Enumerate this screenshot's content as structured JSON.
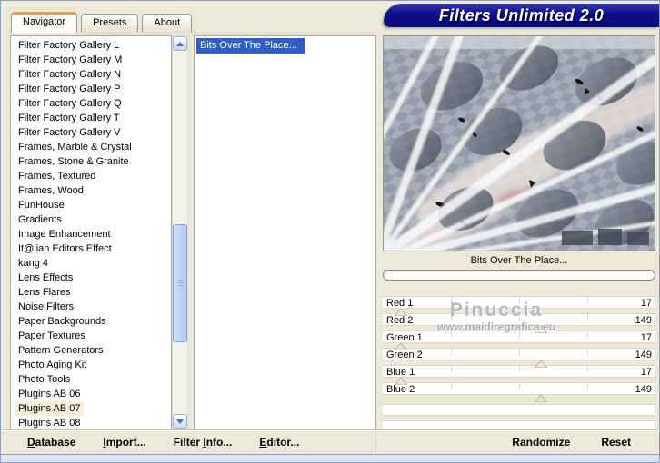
{
  "window": {
    "title": "Filters Unlimited 2.0"
  },
  "tabs": [
    {
      "label": "Navigator",
      "active": true
    },
    {
      "label": "Presets",
      "active": false
    },
    {
      "label": "About",
      "active": false
    }
  ],
  "category_list": {
    "items": [
      "Filter Factory Gallery L",
      "Filter Factory Gallery M",
      "Filter Factory Gallery N",
      "Filter Factory Gallery P",
      "Filter Factory Gallery Q",
      "Filter Factory Gallery T",
      "Filter Factory Gallery V",
      "Frames, Marble & Crystal",
      "Frames, Stone & Granite",
      "Frames, Textured",
      "Frames, Wood",
      "FunHouse",
      "Gradients",
      "Image Enhancement",
      "It@lian Editors Effect",
      "kang 4",
      "Lens Effects",
      "Lens Flares",
      "Noise Filters",
      "Paper Backgrounds",
      "Paper Textures",
      "Pattern Generators",
      "Photo Aging Kit",
      "Photo Tools",
      "Plugins AB 06",
      "Plugins AB 07",
      "Plugins AB 08"
    ],
    "selected": "Plugins AB 07"
  },
  "filter_list": {
    "items": [
      "Bits Over The Place..."
    ],
    "selected": "Bits Over The Place..."
  },
  "preview": {
    "caption": "Bits Over The Place...",
    "progress_percent": 0
  },
  "sliders": {
    "range": {
      "min": 0,
      "max": 255
    },
    "items": [
      {
        "label": "Red 1",
        "value": 17
      },
      {
        "label": "Red 2",
        "value": 149
      },
      {
        "label": "Green 1",
        "value": 17
      },
      {
        "label": "Green 2",
        "value": 149
      },
      {
        "label": "Blue 1",
        "value": 17
      },
      {
        "label": "Blue 2",
        "value": 149
      }
    ]
  },
  "watermark": {
    "line1": "Pinuccia",
    "line2": "www.maidiregrafica.eu"
  },
  "footer": {
    "buttons_left": [
      {
        "name": "database",
        "label": "Database",
        "mnemonic_index": 0
      },
      {
        "name": "import",
        "label": "Import...",
        "mnemonic_index": 0
      },
      {
        "name": "filter-info",
        "label": "Filter Info...",
        "mnemonic_index": 7
      },
      {
        "name": "editor",
        "label": "Editor...",
        "mnemonic_index": 0
      }
    ],
    "buttons_right": [
      {
        "name": "randomize",
        "label": "Randomize",
        "mnemonic_index": -1
      },
      {
        "name": "reset",
        "label": "Reset",
        "mnemonic_index": -1
      }
    ]
  },
  "colors": {
    "dialog_bg": "#ece9d8",
    "banner_navy": "#0d0d8c",
    "active_tab_orange": "#e8a33d",
    "selection_blue": "#2e5fc3",
    "category_highlight": "#f1eedb",
    "footer_strip_blue": "#d9e4f6"
  }
}
